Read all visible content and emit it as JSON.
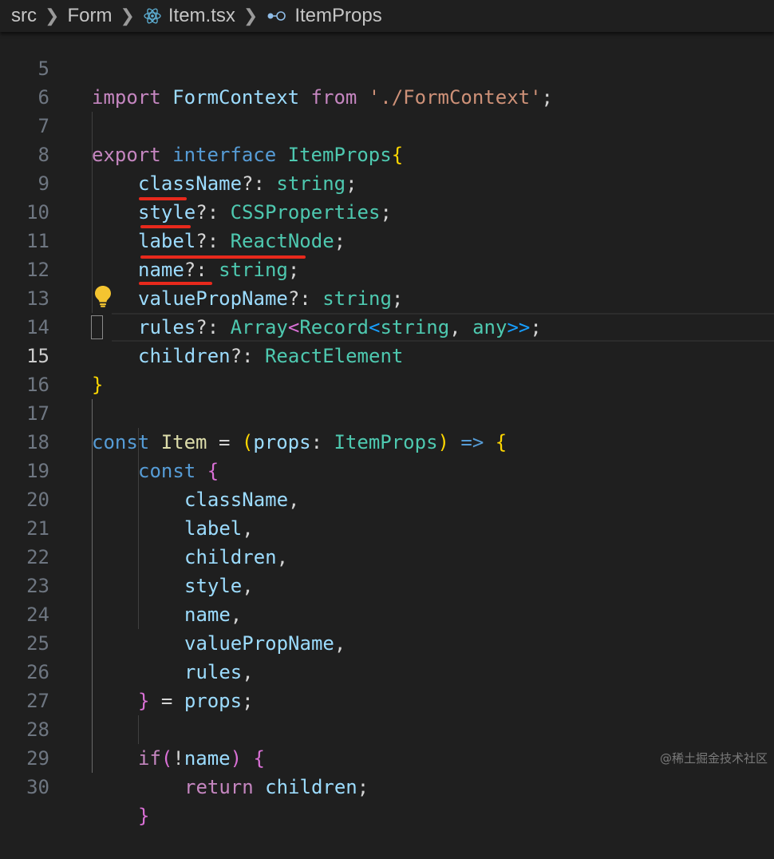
{
  "breadcrumb": {
    "part1": "src",
    "part2": "Form",
    "part3": "Item.tsx",
    "part4": "ItemProps"
  },
  "colors": {
    "background": "#1f1f1f",
    "keyword": "#569cd6",
    "control": "#c586c0",
    "type": "#4ec9b0",
    "variable": "#9cdcfe",
    "string": "#ce9178",
    "function": "#dcdcaa",
    "annotation": "#e8291c"
  },
  "lines": {
    "l5": {
      "num": "5",
      "t1": "import",
      "t2": " FormContext ",
      "t3": "from",
      "t4": " ",
      "t5": "'./FormContext'",
      "t6": ";"
    },
    "l6": {
      "num": "6"
    },
    "l7": {
      "num": "7",
      "t1": "export",
      "t2": " ",
      "t3": "interface",
      "t4": " ",
      "t5": "ItemProps",
      "t6": "{"
    },
    "l8": {
      "num": "8",
      "t1": "className",
      "t2": "?: ",
      "t3": "string",
      "t4": ";"
    },
    "l9": {
      "num": "9",
      "t1": "style",
      "t2": "?: ",
      "t3": "CSSProperties",
      "t4": ";"
    },
    "l10": {
      "num": "10",
      "t1": "label",
      "t2": "?: ",
      "t3": "ReactNode",
      "t4": ";"
    },
    "l11": {
      "num": "11",
      "t1": "name",
      "t2": "?: ",
      "t3": "string",
      "t4": ";"
    },
    "l12": {
      "num": "12",
      "t1": "valuePropName",
      "t2": "?: ",
      "t3": "string",
      "t4": ";"
    },
    "l13": {
      "num": "13",
      "t1": "rules",
      "t2": "?: ",
      "t3": "Array",
      "t4": "<",
      "t5": "Record",
      "t6": "<",
      "t7": "string",
      "t8": ", ",
      "t9": "any",
      "t10": ">>",
      "t11": ";"
    },
    "l14": {
      "num": "14",
      "t1": "children",
      "t2": "?: ",
      "t3": "ReactElement"
    },
    "l15": {
      "num": "15",
      "t1": "}"
    },
    "l16": {
      "num": "16"
    },
    "l17": {
      "num": "17",
      "t1": "const",
      "t2": " ",
      "t3": "Item",
      "t4": " = ",
      "t5": "(",
      "t6": "props",
      "t7": ": ",
      "t8": "ItemProps",
      "t9": ")",
      "t10": " ",
      "t11": "=>",
      "t12": " ",
      "t13": "{"
    },
    "l18": {
      "num": "18",
      "t1": "const",
      "t2": " ",
      "t3": "{"
    },
    "l19": {
      "num": "19",
      "t1": "className",
      "t2": ","
    },
    "l20": {
      "num": "20",
      "t1": "label",
      "t2": ","
    },
    "l21": {
      "num": "21",
      "t1": "children",
      "t2": ","
    },
    "l22": {
      "num": "22",
      "t1": "style",
      "t2": ","
    },
    "l23": {
      "num": "23",
      "t1": "name",
      "t2": ","
    },
    "l24": {
      "num": "24",
      "t1": "valuePropName",
      "t2": ","
    },
    "l25": {
      "num": "25",
      "t1": "rules",
      "t2": ","
    },
    "l26": {
      "num": "26",
      "t1": "}",
      "t2": " = ",
      "t3": "props",
      "t4": ";"
    },
    "l27": {
      "num": "27"
    },
    "l28": {
      "num": "28",
      "t1": "if",
      "t2": "(",
      "t3": "!",
      "t4": "name",
      "t5": ")",
      "t6": " ",
      "t7": "{"
    },
    "l29": {
      "num": "29",
      "t1": "return",
      "t2": " ",
      "t3": "children",
      "t4": ";"
    },
    "l30": {
      "num": "30",
      "t1": "}"
    }
  },
  "icons": {
    "breadcrumb_file": "react-icon",
    "breadcrumb_symbol": "interface-icon",
    "editor_hint": "lightbulb-icon"
  },
  "watermark": "@稀土掘金技术社区"
}
